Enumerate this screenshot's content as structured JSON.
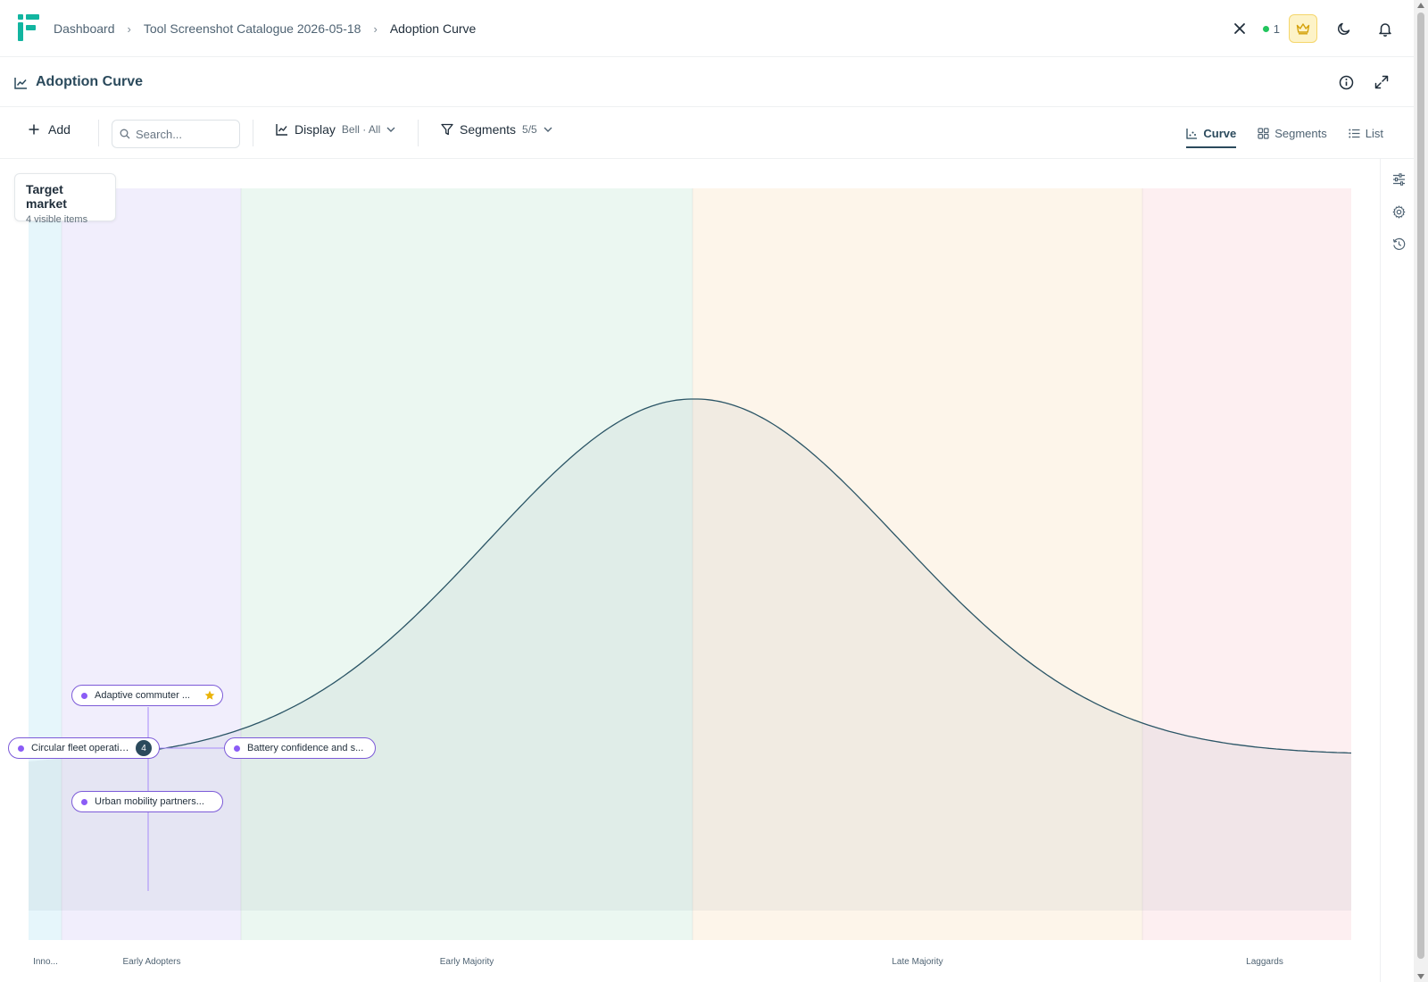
{
  "breadcrumb": {
    "items": [
      "Dashboard",
      "Tool Screenshot Catalogue 2026-05-18"
    ],
    "current": "Adoption Curve"
  },
  "header": {
    "presence_count": "1",
    "icons": [
      "close-icon",
      "crown-icon",
      "moon-icon",
      "bell-icon"
    ]
  },
  "page": {
    "title": "Adoption Curve"
  },
  "toolbar": {
    "add_label": "Add",
    "search_placeholder": "Search...",
    "display_label": "Display",
    "display_value": "Bell · All",
    "segments_label": "Segments",
    "segments_value": "5/5",
    "views": [
      {
        "label": "Curve",
        "active": true
      },
      {
        "label": "Segments",
        "active": false
      },
      {
        "label": "List",
        "active": false
      }
    ]
  },
  "target_card": {
    "title": "Target market",
    "subtitle": "4 visible items"
  },
  "segments": [
    {
      "label": "Inno...",
      "color": "#e6f6fb"
    },
    {
      "label": "Early Adopters",
      "color": "#f1eefc"
    },
    {
      "label": "Early Majority",
      "color": "#ebf7f1"
    },
    {
      "label": "Late Majority",
      "color": "#fdf5ea"
    },
    {
      "label": "Laggards",
      "color": "#fdeff1"
    }
  ],
  "items": [
    {
      "label": "Adaptive commuter ...",
      "starred": true
    },
    {
      "label": "Circular fleet operations",
      "count": "4"
    },
    {
      "label": "Battery confidence and s..."
    },
    {
      "label": "Urban mobility partners..."
    }
  ],
  "colors": {
    "accent": "#2b4a5c",
    "curve": "#2b5566",
    "item_border": "#7c5ad8",
    "item_dot": "#8b5cf6",
    "star": "#eab308",
    "presence": "#22c55e"
  }
}
